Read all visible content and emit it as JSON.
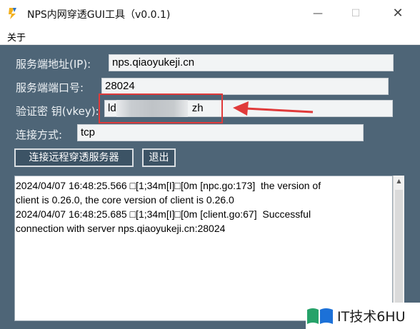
{
  "window": {
    "title": "NPS内网穿透GUI工具（v0.0.1)",
    "min_glyph": "—",
    "max_glyph": "☐",
    "close_glyph": "✕"
  },
  "menu": {
    "about": "关于"
  },
  "form": {
    "server_label": "服务端地址(IP):",
    "server_value": "nps.qiaoyukeji.cn",
    "port_label": "服务端端口号:",
    "port_value": "28024",
    "vkey_label": "验证密 钥(vkey):",
    "vkey_value_visible_start": "ld",
    "vkey_value_visible_end": "zh",
    "conn_label": "连接方式:",
    "conn_value": "tcp"
  },
  "buttons": {
    "connect": "连接远程穿透服务器",
    "exit": "退出"
  },
  "log": {
    "lines": [
      "2024/04/07 16:48:25.566 □[1;34m[I]□[0m [npc.go:173]  the version of",
      "client is 0.26.0, the core version of client is 0.26.0",
      "2024/04/07 16:48:25.685 □[1;34m[I]□[0m [client.go:67]  Successful",
      "connection with server nps.qiaoyukeji.cn:28024"
    ]
  },
  "icons": {
    "app": "nps-logo-icon",
    "arrow": "red-arrow-icon",
    "watermark": "it-logo-icon"
  },
  "colors": {
    "panel": "#4e6577",
    "button": "#3c5365",
    "highlight": "#e03a3a"
  },
  "watermark": {
    "text": "IT技术6HU"
  }
}
